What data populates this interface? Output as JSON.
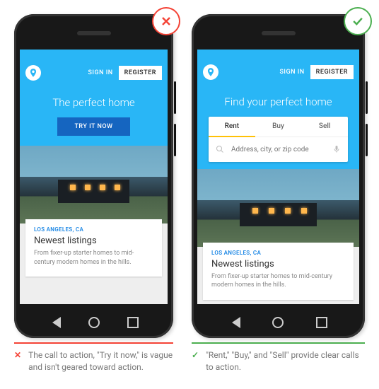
{
  "nav": {
    "signin": "SIGN IN",
    "register": "REGISTER"
  },
  "listing": {
    "location": "LOS ANGELES, CA",
    "title": "Newest listings",
    "desc": "From fixer-up starter homes to mid-century modern homes in the hills."
  },
  "left": {
    "badge": "X",
    "heroTitle": "The perfect home",
    "cta": "TRY IT NOW",
    "captionMark": "✕",
    "caption": "The call to action, \"Try it now,\" is vague and isn't geared toward action."
  },
  "right": {
    "badge": "✓",
    "heroTitle": "Find your perfect home",
    "tabs": [
      "Rent",
      "Buy",
      "Sell"
    ],
    "searchPlaceholder": "Address, city, or zip code",
    "captionMark": "✓",
    "caption": "\"Rent,\" \"Buy,\" and \"Sell\" provide clear calls to action."
  }
}
